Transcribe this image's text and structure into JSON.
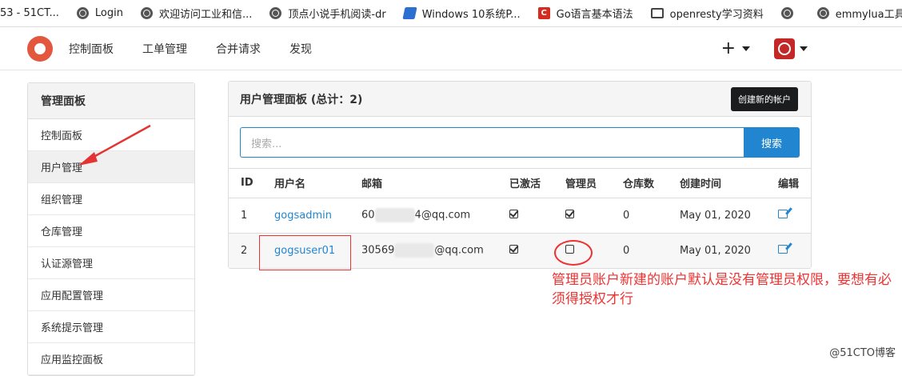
{
  "bookmarks": [
    {
      "label": "53 - 51CT...",
      "icon": "none"
    },
    {
      "label": "Login",
      "icon": "globe-icon"
    },
    {
      "label": "欢迎访问工业和信...",
      "icon": "globe-icon"
    },
    {
      "label": "顶点小说手机阅读-dr",
      "icon": "globe-icon"
    },
    {
      "label": "Windows 10系统P...",
      "icon": "page-icon"
    },
    {
      "label": "Go语言基本语法",
      "icon": "c-icon"
    },
    {
      "label": "openresty学习资料",
      "icon": "book-icon"
    },
    {
      "label": "",
      "icon": "globe-icon"
    },
    {
      "label": "emmylua工具使用...",
      "icon": "globe-icon"
    }
  ],
  "navbar": {
    "items": [
      "控制面板",
      "工单管理",
      "合并请求",
      "发现"
    ],
    "plus": "+"
  },
  "sidebar": {
    "title": "管理面板",
    "items": [
      "控制面板",
      "用户管理",
      "组织管理",
      "仓库管理",
      "认证源管理",
      "应用配置管理",
      "系统提示管理",
      "应用监控面板"
    ],
    "active_index": 1
  },
  "panel": {
    "title": "用户管理面板 (总计：2)",
    "create_label": "创建新的帐户",
    "search_placeholder": "搜索...",
    "search_label": "搜索",
    "columns": [
      "ID",
      "用户名",
      "邮箱",
      "已激活",
      "管理员",
      "仓库数",
      "创建时间",
      "编辑"
    ],
    "rows": [
      {
        "id": "1",
        "username": "gogsadmin",
        "email_prefix": "60",
        "email_suffix": "4@qq.com",
        "activated": true,
        "admin": true,
        "repos": "0",
        "created": "May 01, 2020"
      },
      {
        "id": "2",
        "username": "gogsuser01",
        "email_prefix": "30569",
        "email_suffix": "@qq.com",
        "activated": true,
        "admin": false,
        "repos": "0",
        "created": "May 01, 2020"
      }
    ]
  },
  "annotation": {
    "text": "管理员账户新建的账户默认是没有管理员权限，要想有必须得授权才行"
  },
  "watermark": "@51CTO博客",
  "colors": {
    "accent": "#2185d0",
    "annotation": "#e33333",
    "logo": "#e4573f"
  }
}
